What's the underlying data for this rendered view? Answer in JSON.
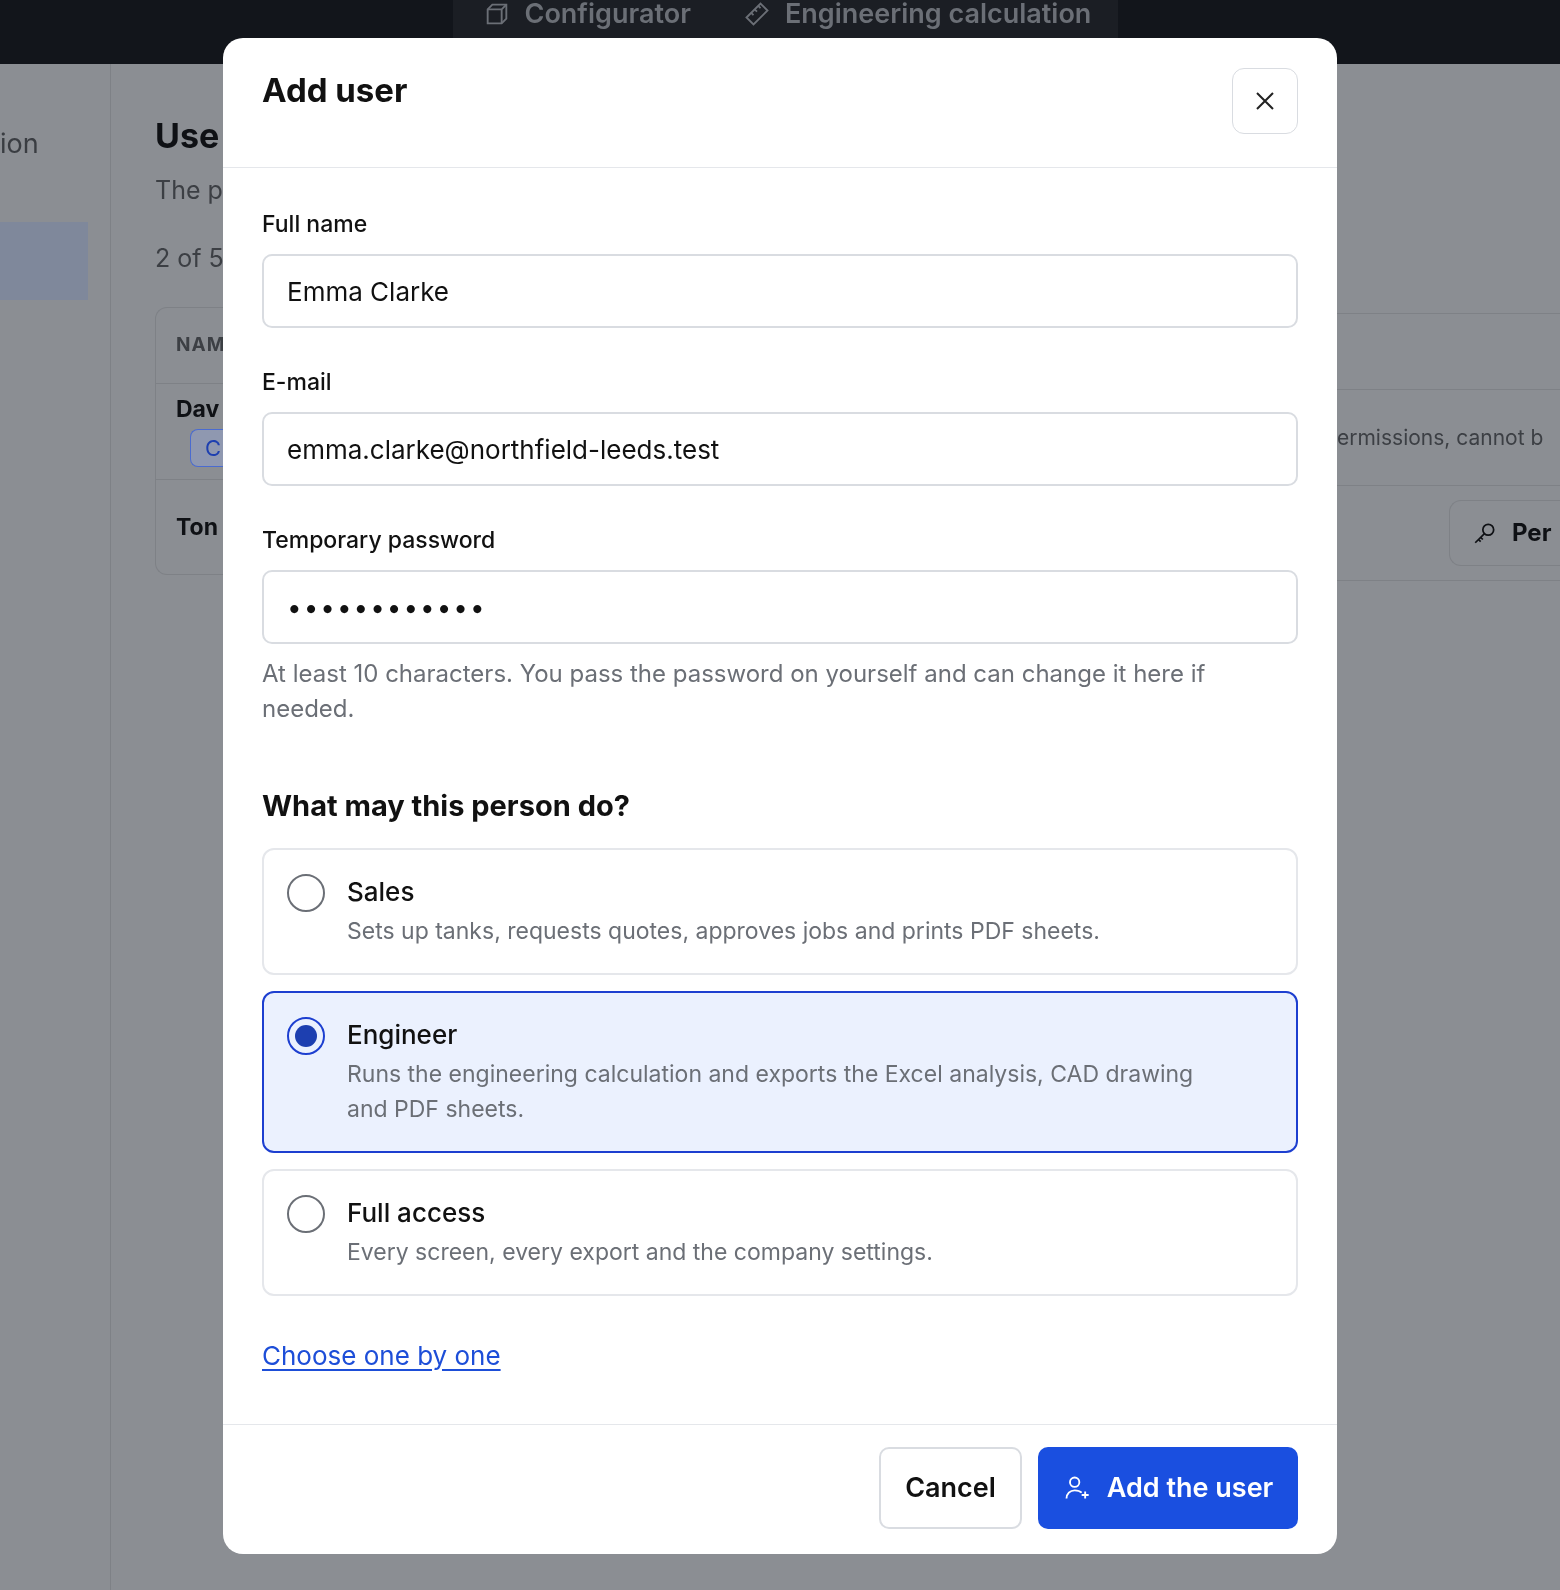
{
  "top_bar": {
    "tabs": [
      {
        "label": "Configurator"
      },
      {
        "label": "Engineering calculation"
      }
    ]
  },
  "sidebar": {
    "items": [
      {
        "label": "ion",
        "selected": false
      },
      {
        "selected": true
      }
    ]
  },
  "background": {
    "heading": "Use",
    "subtitle": "The p",
    "count": "2 of 5",
    "table": {
      "column_1": "NAM",
      "rows": [
        {
          "name": "Dav",
          "badge": "C",
          "note": "ermissions, cannot b"
        },
        {
          "name": "Ton",
          "button": "Per"
        }
      ]
    }
  },
  "dialog": {
    "title": "Add user",
    "fields": [
      {
        "label": "Full name",
        "value": "Emma Clarke",
        "kind": "text"
      },
      {
        "label": "E-mail",
        "value": "emma.clarke@northfield-leeds.test",
        "kind": "text"
      },
      {
        "label": "Temporary password",
        "value": "••••••••••••",
        "kind": "password",
        "hint": "At least 10 characters. You pass the password on yourself and can change it here if needed."
      }
    ],
    "roles_heading": "What may this person do?",
    "roles": [
      {
        "title": "Sales",
        "description": "Sets up tanks, requests quotes, approves jobs and prints PDF sheets.",
        "selected": false
      },
      {
        "title": "Engineer",
        "description": "Runs the engineering calculation and exports the Excel analysis, CAD drawing and PDF sheets.",
        "selected": true
      },
      {
        "title": "Full access",
        "description": "Every screen, every export and the company settings.",
        "selected": false
      }
    ],
    "link": "Choose one by one",
    "buttons": [
      {
        "label": "Cancel",
        "kind": "secondary"
      },
      {
        "label": "Add the user",
        "kind": "primary"
      }
    ]
  }
}
